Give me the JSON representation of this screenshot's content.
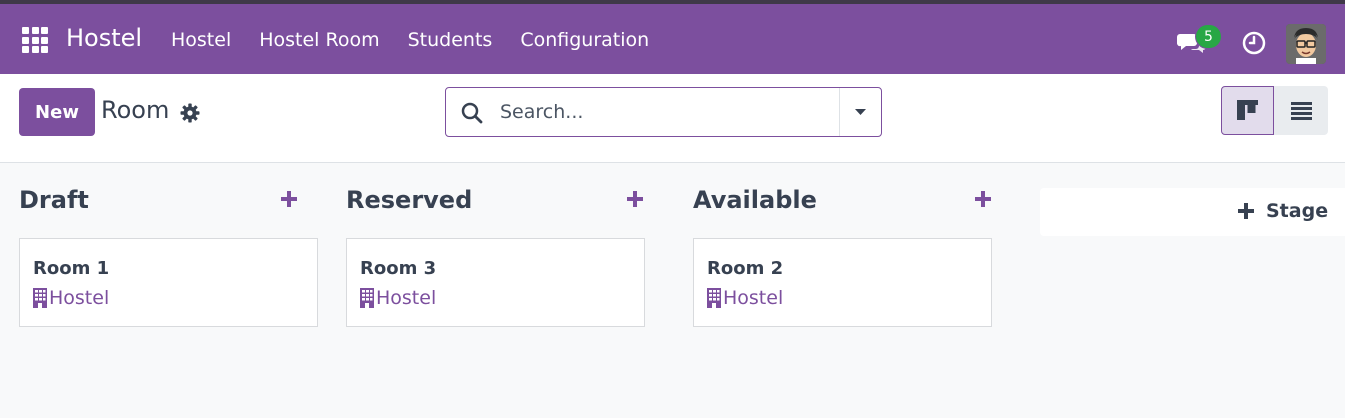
{
  "app": {
    "brand": "Hostel",
    "menu": [
      "Hostel",
      "Hostel Room",
      "Students",
      "Configuration"
    ],
    "notifications_count": "5",
    "accent_color": "#7c4f9e"
  },
  "control": {
    "new_label": "New",
    "title": "Room",
    "search_placeholder": "Search..."
  },
  "kanban": {
    "columns": [
      {
        "name": "Draft",
        "cards": [
          {
            "title": "Room 1",
            "hostel": "Hostel"
          }
        ]
      },
      {
        "name": "Reserved",
        "cards": [
          {
            "title": "Room 3",
            "hostel": "Hostel"
          }
        ]
      },
      {
        "name": "Available",
        "cards": [
          {
            "title": "Room 2",
            "hostel": "Hostel"
          }
        ]
      }
    ],
    "add_stage_label": "Stage"
  }
}
